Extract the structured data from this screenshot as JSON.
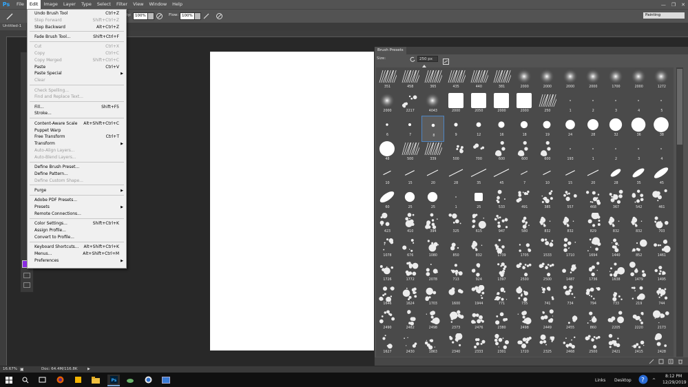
{
  "app": {
    "logo": "Ps",
    "icon": "photoshop-logo-icon"
  },
  "menubar": {
    "items": [
      "File",
      "Edit",
      "Image",
      "Layer",
      "Type",
      "Select",
      "Filter",
      "View",
      "Window",
      "Help"
    ],
    "active": "Edit",
    "controls": [
      "—",
      "❐",
      "✕"
    ]
  },
  "options_bar": {
    "opacity_label": "ity:",
    "opacity_value": "100%",
    "flow_label": "Flow:",
    "flow_value": "100%",
    "workspace": "Painting"
  },
  "document": {
    "tab_title": "Untitled-1 @"
  },
  "edit_menu": {
    "items": [
      {
        "label": "Undo Brush Tool",
        "shortcut": "Ctrl+Z",
        "disabled": false
      },
      {
        "label": "Step Forward",
        "shortcut": "Shift+Ctrl+Z",
        "disabled": true
      },
      {
        "label": "Step Backward",
        "shortcut": "Alt+Ctrl+Z",
        "disabled": false
      },
      {
        "sep": true
      },
      {
        "label": "Fade Brush Tool...",
        "shortcut": "Shift+Ctrl+F",
        "disabled": false
      },
      {
        "sep": true
      },
      {
        "label": "Cut",
        "shortcut": "Ctrl+X",
        "disabled": true
      },
      {
        "label": "Copy",
        "shortcut": "Ctrl+C",
        "disabled": true
      },
      {
        "label": "Copy Merged",
        "shortcut": "Shift+Ctrl+C",
        "disabled": true
      },
      {
        "label": "Paste",
        "shortcut": "Ctrl+V",
        "disabled": false
      },
      {
        "label": "Paste Special",
        "shortcut": "",
        "disabled": false,
        "submenu": true
      },
      {
        "label": "Clear",
        "shortcut": "",
        "disabled": true
      },
      {
        "sep": true
      },
      {
        "label": "Check Spelling...",
        "shortcut": "",
        "disabled": true
      },
      {
        "label": "Find and Replace Text...",
        "shortcut": "",
        "disabled": true
      },
      {
        "sep": true
      },
      {
        "label": "Fill...",
        "shortcut": "Shift+F5",
        "disabled": false
      },
      {
        "label": "Stroke...",
        "shortcut": "",
        "disabled": false
      },
      {
        "sep": true
      },
      {
        "label": "Content-Aware Scale",
        "shortcut": "Alt+Shift+Ctrl+C",
        "disabled": false
      },
      {
        "label": "Puppet Warp",
        "shortcut": "",
        "disabled": false
      },
      {
        "label": "Free Transform",
        "shortcut": "Ctrl+T",
        "disabled": false
      },
      {
        "label": "Transform",
        "shortcut": "",
        "disabled": false,
        "submenu": true
      },
      {
        "label": "Auto-Align Layers...",
        "shortcut": "",
        "disabled": true
      },
      {
        "label": "Auto-Blend Layers...",
        "shortcut": "",
        "disabled": true
      },
      {
        "sep": true
      },
      {
        "label": "Define Brush Preset...",
        "shortcut": "",
        "disabled": false
      },
      {
        "label": "Define Pattern...",
        "shortcut": "",
        "disabled": false
      },
      {
        "label": "Define Custom Shape...",
        "shortcut": "",
        "disabled": true
      },
      {
        "sep": true
      },
      {
        "label": "Purge",
        "shortcut": "",
        "disabled": false,
        "submenu": true
      },
      {
        "sep": true
      },
      {
        "label": "Adobe PDF Presets...",
        "shortcut": "",
        "disabled": false
      },
      {
        "label": "Presets",
        "shortcut": "",
        "disabled": false,
        "submenu": true
      },
      {
        "label": "Remote Connections...",
        "shortcut": "",
        "disabled": false
      },
      {
        "sep": true
      },
      {
        "label": "Color Settings...",
        "shortcut": "Shift+Ctrl+K",
        "disabled": false
      },
      {
        "label": "Assign Profile...",
        "shortcut": "",
        "disabled": false
      },
      {
        "label": "Convert to Profile...",
        "shortcut": "",
        "disabled": false
      },
      {
        "sep": true
      },
      {
        "label": "Keyboard Shortcuts...",
        "shortcut": "Alt+Shift+Ctrl+K",
        "disabled": false
      },
      {
        "label": "Menus...",
        "shortcut": "Alt+Shift+Ctrl+M",
        "disabled": false
      },
      {
        "label": "Preferences",
        "shortcut": "",
        "disabled": false,
        "submenu": true
      }
    ]
  },
  "brush_panel": {
    "title": "Brush Presets",
    "size_label": "Size:",
    "size_value": "250 px",
    "selected_index": 28,
    "rows": [
      [
        {
          "n": "351",
          "k": "hatch"
        },
        {
          "n": "458",
          "k": "hatch"
        },
        {
          "n": "365",
          "k": "hatch"
        },
        {
          "n": "435",
          "k": "hatch"
        },
        {
          "n": "440",
          "k": "hatch"
        },
        {
          "n": "381",
          "k": "hatch"
        },
        {
          "n": "2000",
          "k": "soft"
        },
        {
          "n": "2000",
          "k": "soft"
        },
        {
          "n": "2000",
          "k": "soft"
        },
        {
          "n": "2000",
          "k": "soft"
        },
        {
          "n": "1700",
          "k": "soft"
        },
        {
          "n": "2000",
          "k": "soft"
        },
        {
          "n": "1272",
          "k": "soft"
        }
      ],
      [
        {
          "n": "2000",
          "k": "soft"
        },
        {
          "n": "2217",
          "k": "splat"
        },
        {
          "n": "4043",
          "k": "soft"
        },
        {
          "n": "2000",
          "k": "square"
        },
        {
          "n": "2050",
          "k": "square"
        },
        {
          "n": "2000",
          "k": "square"
        },
        {
          "n": "2000",
          "k": "square"
        },
        {
          "n": "250",
          "k": "hatch"
        },
        {
          "n": "1",
          "k": "dot"
        },
        {
          "n": "2",
          "k": "dot"
        },
        {
          "n": "3",
          "k": "dot"
        },
        {
          "n": "4",
          "k": "dot"
        },
        {
          "n": "5",
          "k": "dot"
        }
      ],
      [
        {
          "n": "6",
          "k": "round"
        },
        {
          "n": "7",
          "k": "round"
        },
        {
          "n": "8",
          "k": "round"
        },
        {
          "n": "9",
          "k": "round"
        },
        {
          "n": "12",
          "k": "round"
        },
        {
          "n": "16",
          "k": "round"
        },
        {
          "n": "18",
          "k": "round"
        },
        {
          "n": "19",
          "k": "round"
        },
        {
          "n": "24",
          "k": "round"
        },
        {
          "n": "28",
          "k": "round"
        },
        {
          "n": "32",
          "k": "round"
        },
        {
          "n": "36",
          "k": "round"
        },
        {
          "n": "38",
          "k": "round"
        }
      ],
      [
        {
          "n": "48",
          "k": "round"
        },
        {
          "n": "500",
          "k": "hatch"
        },
        {
          "n": "339",
          "k": "hatch"
        },
        {
          "n": "500",
          "k": "splat"
        },
        {
          "n": "700",
          "k": "splat"
        },
        {
          "n": "600",
          "k": "splat"
        },
        {
          "n": "600",
          "k": "splat"
        },
        {
          "n": "600",
          "k": "splat"
        },
        {
          "n": "193",
          "k": "dot"
        },
        {
          "n": "1",
          "k": "dot"
        },
        {
          "n": "2",
          "k": "dot"
        },
        {
          "n": "3",
          "k": "dot"
        },
        {
          "n": "4",
          "k": "dot"
        }
      ],
      [
        {
          "n": "10",
          "k": "stroke"
        },
        {
          "n": "15",
          "k": "stroke"
        },
        {
          "n": "20",
          "k": "stroke"
        },
        {
          "n": "28",
          "k": "stroke"
        },
        {
          "n": "35",
          "k": "stroke"
        },
        {
          "n": "45",
          "k": "stroke"
        },
        {
          "n": "7",
          "k": "stroke"
        },
        {
          "n": "10",
          "k": "stroke"
        },
        {
          "n": "15",
          "k": "stroke"
        },
        {
          "n": "20",
          "k": "stroke"
        },
        {
          "n": "28",
          "k": "oval"
        },
        {
          "n": "35",
          "k": "oval"
        },
        {
          "n": "45",
          "k": "oval"
        }
      ],
      [
        {
          "n": "60",
          "k": "oval"
        },
        {
          "n": "25",
          "k": "round"
        },
        {
          "n": "25",
          "k": "round"
        },
        {
          "n": "1",
          "k": "dot"
        },
        {
          "n": "25",
          "k": "square"
        },
        {
          "n": "533",
          "k": "splat"
        },
        {
          "n": "491",
          "k": "splat"
        },
        {
          "n": "385",
          "k": "splat"
        },
        {
          "n": "557",
          "k": "splat"
        },
        {
          "n": "468",
          "k": "splat"
        },
        {
          "n": "367",
          "k": "splat"
        },
        {
          "n": "542",
          "k": "splat"
        },
        {
          "n": "461",
          "k": "splat"
        }
      ],
      [
        {
          "n": "423",
          "k": "splat"
        },
        {
          "n": "410",
          "k": "splat"
        },
        {
          "n": "394",
          "k": "splat"
        },
        {
          "n": "325",
          "k": "splat"
        },
        {
          "n": "615",
          "k": "splat"
        },
        {
          "n": "947",
          "k": "splat"
        },
        {
          "n": "580",
          "k": "splat"
        },
        {
          "n": "832",
          "k": "splat"
        },
        {
          "n": "832",
          "k": "splat"
        },
        {
          "n": "829",
          "k": "splat"
        },
        {
          "n": "832",
          "k": "splat"
        },
        {
          "n": "832",
          "k": "splat"
        },
        {
          "n": "703",
          "k": "splat"
        }
      ],
      [
        {
          "n": "1078",
          "k": "splat"
        },
        {
          "n": "676",
          "k": "splat"
        },
        {
          "n": "1080",
          "k": "splat"
        },
        {
          "n": "850",
          "k": "splat"
        },
        {
          "n": "832",
          "k": "splat"
        },
        {
          "n": "1739",
          "k": "splat"
        },
        {
          "n": "1705",
          "k": "splat"
        },
        {
          "n": "1533",
          "k": "splat"
        },
        {
          "n": "1710",
          "k": "splat"
        },
        {
          "n": "1694",
          "k": "splat"
        },
        {
          "n": "1440",
          "k": "splat"
        },
        {
          "n": "852",
          "k": "splat"
        },
        {
          "n": "1461",
          "k": "splat"
        }
      ],
      [
        {
          "n": "1726",
          "k": "splat"
        },
        {
          "n": "1772",
          "k": "splat"
        },
        {
          "n": "2078",
          "k": "splat"
        },
        {
          "n": "713",
          "k": "splat"
        },
        {
          "n": "924",
          "k": "splat"
        },
        {
          "n": "1397",
          "k": "splat"
        },
        {
          "n": "2500",
          "k": "splat"
        },
        {
          "n": "2500",
          "k": "splat"
        },
        {
          "n": "1487",
          "k": "splat"
        },
        {
          "n": "1736",
          "k": "splat"
        },
        {
          "n": "1638",
          "k": "splat"
        },
        {
          "n": "1479",
          "k": "splat"
        },
        {
          "n": "1495",
          "k": "splat"
        }
      ],
      [
        {
          "n": "1646",
          "k": "splat"
        },
        {
          "n": "1624",
          "k": "splat"
        },
        {
          "n": "1703",
          "k": "splat"
        },
        {
          "n": "1600",
          "k": "splat"
        },
        {
          "n": "1944",
          "k": "splat"
        },
        {
          "n": "771",
          "k": "splat"
        },
        {
          "n": "735",
          "k": "splat"
        },
        {
          "n": "741",
          "k": "splat"
        },
        {
          "n": "734",
          "k": "splat"
        },
        {
          "n": "794",
          "k": "splat"
        },
        {
          "n": "733",
          "k": "splat"
        },
        {
          "n": "219",
          "k": "splat"
        },
        {
          "n": "744",
          "k": "splat"
        }
      ],
      [
        {
          "n": "2490",
          "k": "splat"
        },
        {
          "n": "2482",
          "k": "splat"
        },
        {
          "n": "2498",
          "k": "splat"
        },
        {
          "n": "2373",
          "k": "splat"
        },
        {
          "n": "2476",
          "k": "splat"
        },
        {
          "n": "2380",
          "k": "splat"
        },
        {
          "n": "2498",
          "k": "splat"
        },
        {
          "n": "2449",
          "k": "splat"
        },
        {
          "n": "2455",
          "k": "splat"
        },
        {
          "n": "860",
          "k": "splat"
        },
        {
          "n": "2205",
          "k": "splat"
        },
        {
          "n": "2220",
          "k": "splat"
        },
        {
          "n": "2173",
          "k": "splat"
        }
      ],
      [
        {
          "n": "1627",
          "k": "splat"
        },
        {
          "n": "2430",
          "k": "splat"
        },
        {
          "n": "1863",
          "k": "splat"
        },
        {
          "n": "2340",
          "k": "splat"
        },
        {
          "n": "2333",
          "k": "splat"
        },
        {
          "n": "2301",
          "k": "splat"
        },
        {
          "n": "1720",
          "k": "splat"
        },
        {
          "n": "2325",
          "k": "splat"
        },
        {
          "n": "2468",
          "k": "splat"
        },
        {
          "n": "2500",
          "k": "splat"
        },
        {
          "n": "2421",
          "k": "splat"
        },
        {
          "n": "2415",
          "k": "splat"
        },
        {
          "n": "2428",
          "k": "splat"
        }
      ]
    ]
  },
  "status_bar": {
    "zoom": "16.67%",
    "doc_info": "Doc: 64.4M/116.8K"
  },
  "taskbar": {
    "links_label": "Links",
    "desktop_label": "Desktop",
    "time": "8:12 PM",
    "date": "12/29/2019"
  },
  "colors": {
    "foreground_swatch": "#8a2be2",
    "menu_highlight": "#ffffff",
    "selection_border": "#4e86c4"
  }
}
